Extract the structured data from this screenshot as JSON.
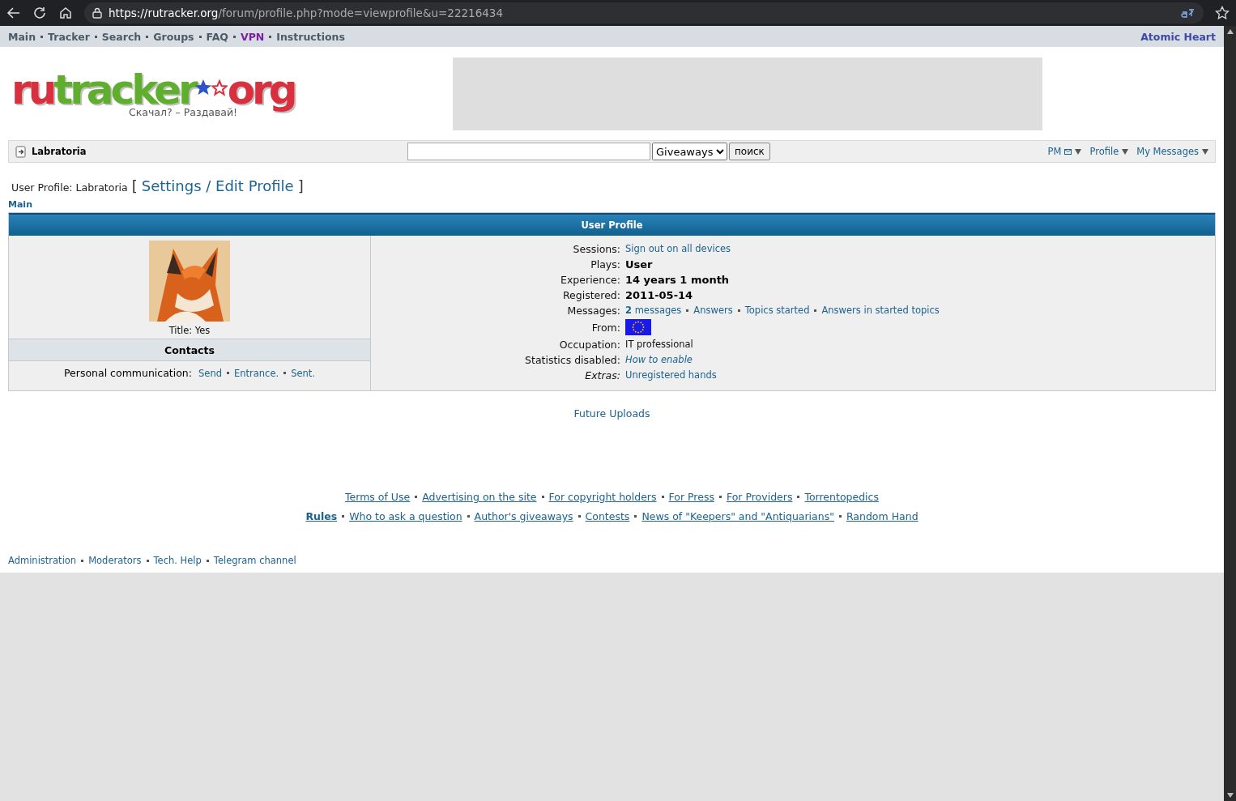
{
  "browser": {
    "url_host": "https://rutracker.org",
    "url_path": "/forum/profile.php?mode=viewprofile&u=22216434"
  },
  "top_nav": {
    "items": [
      {
        "label": "Main",
        "color": "#4c5a66"
      },
      {
        "label": "Tracker",
        "color": "#4c5a66"
      },
      {
        "label": "Search",
        "color": "#4c5a66"
      },
      {
        "label": "Groups",
        "color": "#4c5a66"
      },
      {
        "label": "FAQ",
        "color": "#4c5a66"
      },
      {
        "label": "VPN",
        "color": "#7a1fa0"
      },
      {
        "label": "Instructions",
        "color": "#4c5a66"
      }
    ],
    "right_link": "Atomic Heart"
  },
  "logo": {
    "name_left": "rutracker",
    "name_right": "org",
    "tagline": "Скачал? – Раздавай!"
  },
  "user_bar": {
    "username": "Labratoria",
    "search_category": "Giveaways",
    "search_button": "поиск",
    "menus": [
      {
        "label": "PM",
        "kind": "mail"
      },
      {
        "label": "Profile",
        "kind": "plain"
      },
      {
        "label": "My Messages",
        "kind": "plain"
      }
    ]
  },
  "heading": {
    "label": "User Profile: Labratoria",
    "bracket_open": "[",
    "link": "Settings / Edit Profile",
    "bracket_close": "]"
  },
  "breadcrumb": "Main",
  "profile": {
    "title": "User Profile",
    "avatar": {
      "kind": "picture"
    },
    "user_title": "Title: Yes",
    "contacts_title": "Contacts",
    "contact_label": "Personal communication:",
    "contact_links": [
      "Send",
      "Entrance.",
      "Sent."
    ],
    "fields": [
      {
        "label": "Sessions:",
        "kind": "links",
        "links": [
          "Sign out on all devices"
        ]
      },
      {
        "label": "Plays:",
        "kind": "bold",
        "value": "User"
      },
      {
        "label": "Experience:",
        "kind": "bold",
        "value": "14 years 1 month"
      },
      {
        "label": "Registered:",
        "kind": "bold",
        "value": "2011-05-14"
      },
      {
        "label": "Messages:",
        "kind": "links",
        "links": [
          "**2** messages",
          "Answers",
          "Topics started",
          "Answers in started topics"
        ]
      },
      {
        "label": "From:",
        "kind": "flag"
      },
      {
        "label": "Occupation:",
        "kind": "text",
        "value": "IT professional"
      },
      {
        "label": "Statistics disabled:",
        "kind": "italic_link",
        "value": "How to enable"
      },
      {
        "label": "Extras:",
        "kind": "links",
        "label_italic": true,
        "links": [
          "Unregistered hands"
        ]
      }
    ]
  },
  "future_uploads": "Future Uploads",
  "footer": {
    "info_links": [
      {
        "label": "Terms of Use",
        "bold": false
      },
      {
        "label": "Advertising on the site",
        "bold": false
      },
      {
        "label": "For copyright holders",
        "bold": false
      },
      {
        "label": "For Press",
        "bold": false
      },
      {
        "label": "For Providers",
        "bold": false
      },
      {
        "label": "Torrentopedics",
        "bold": false
      }
    ],
    "help_links": [
      {
        "label": "Rules",
        "bold": true
      },
      {
        "label": "Who to ask a question",
        "bold": false
      },
      {
        "label": "Author's giveaways",
        "bold": false
      },
      {
        "label": "Contests",
        "bold": false
      },
      {
        "label": "News of \"Keepers\" and \"Antiquarians\"",
        "bold": false
      },
      {
        "label": "Random Hand",
        "bold": false
      }
    ],
    "bottom_links": [
      "Administration",
      "Moderators",
      "Tech. Help",
      "Telegram channel"
    ]
  }
}
